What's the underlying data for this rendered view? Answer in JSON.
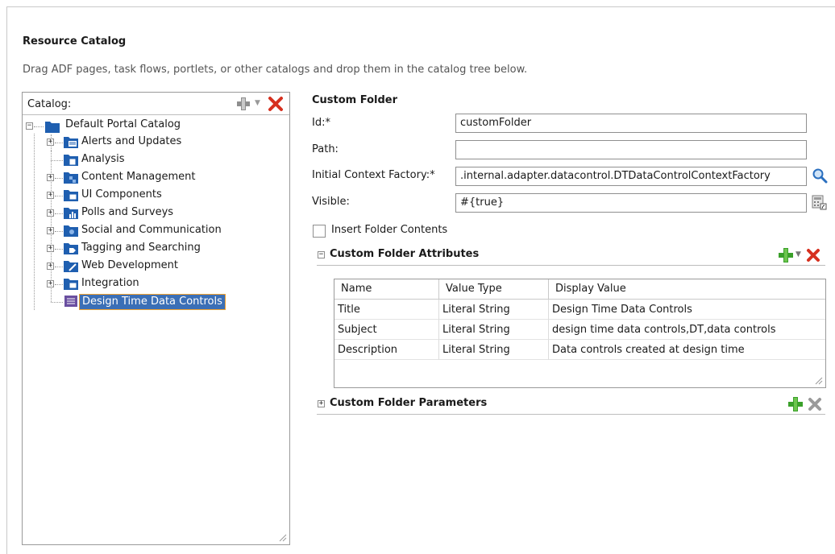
{
  "page": {
    "title": "Resource Catalog",
    "description": "Drag ADF pages, task flows, portlets, or other catalogs and drop them in the catalog tree below."
  },
  "catalog": {
    "label": "Catalog:",
    "tree": {
      "root": "Default Portal Catalog",
      "items": [
        {
          "label": "Alerts and Updates",
          "icon": "alerts-folder-icon"
        },
        {
          "label": "Analysis",
          "icon": "analysis-folder-icon"
        },
        {
          "label": "Content Management",
          "icon": "content-folder-icon"
        },
        {
          "label": "UI Components",
          "icon": "ui-components-folder-icon"
        },
        {
          "label": "Polls and Surveys",
          "icon": "polls-folder-icon"
        },
        {
          "label": "Social and Communication",
          "icon": "social-folder-icon"
        },
        {
          "label": "Tagging and Searching",
          "icon": "tagging-folder-icon"
        },
        {
          "label": "Web Development",
          "icon": "web-dev-folder-icon"
        },
        {
          "label": "Integration",
          "icon": "integration-folder-icon"
        },
        {
          "label": "Design Time Data Controls",
          "icon": "data-controls-icon",
          "selected": true
        }
      ]
    }
  },
  "custom_folder": {
    "title": "Custom Folder",
    "id_label": "Id:*",
    "id_value": "customFolder",
    "path_label": "Path:",
    "path_value": "",
    "icf_label": "Initial Context Factory:*",
    "icf_value": ".internal.adapter.datacontrol.DTDataControlContextFactory",
    "visible_label": "Visible:",
    "visible_value": "#{true}",
    "insert_contents_label": "Insert Folder Contents"
  },
  "attributes": {
    "title": "Custom Folder Attributes",
    "toggle": "−",
    "columns": [
      "Name",
      "Value Type",
      "Display Value"
    ],
    "rows": [
      [
        "Title",
        "Literal String",
        "Design Time Data Controls"
      ],
      [
        "Subject",
        "Literal String",
        "design time data controls,DT,data controls"
      ],
      [
        "Description",
        "Literal String",
        "Data controls created at design time"
      ]
    ]
  },
  "parameters": {
    "title": "Custom Folder Parameters",
    "toggle": "+"
  },
  "colors": {
    "add_green": "#3aa02a",
    "delete_red": "#d6301f",
    "folder_blue": "#1f5fb0",
    "selection_blue": "#3b6fb6",
    "selection_border": "#f0a030"
  }
}
